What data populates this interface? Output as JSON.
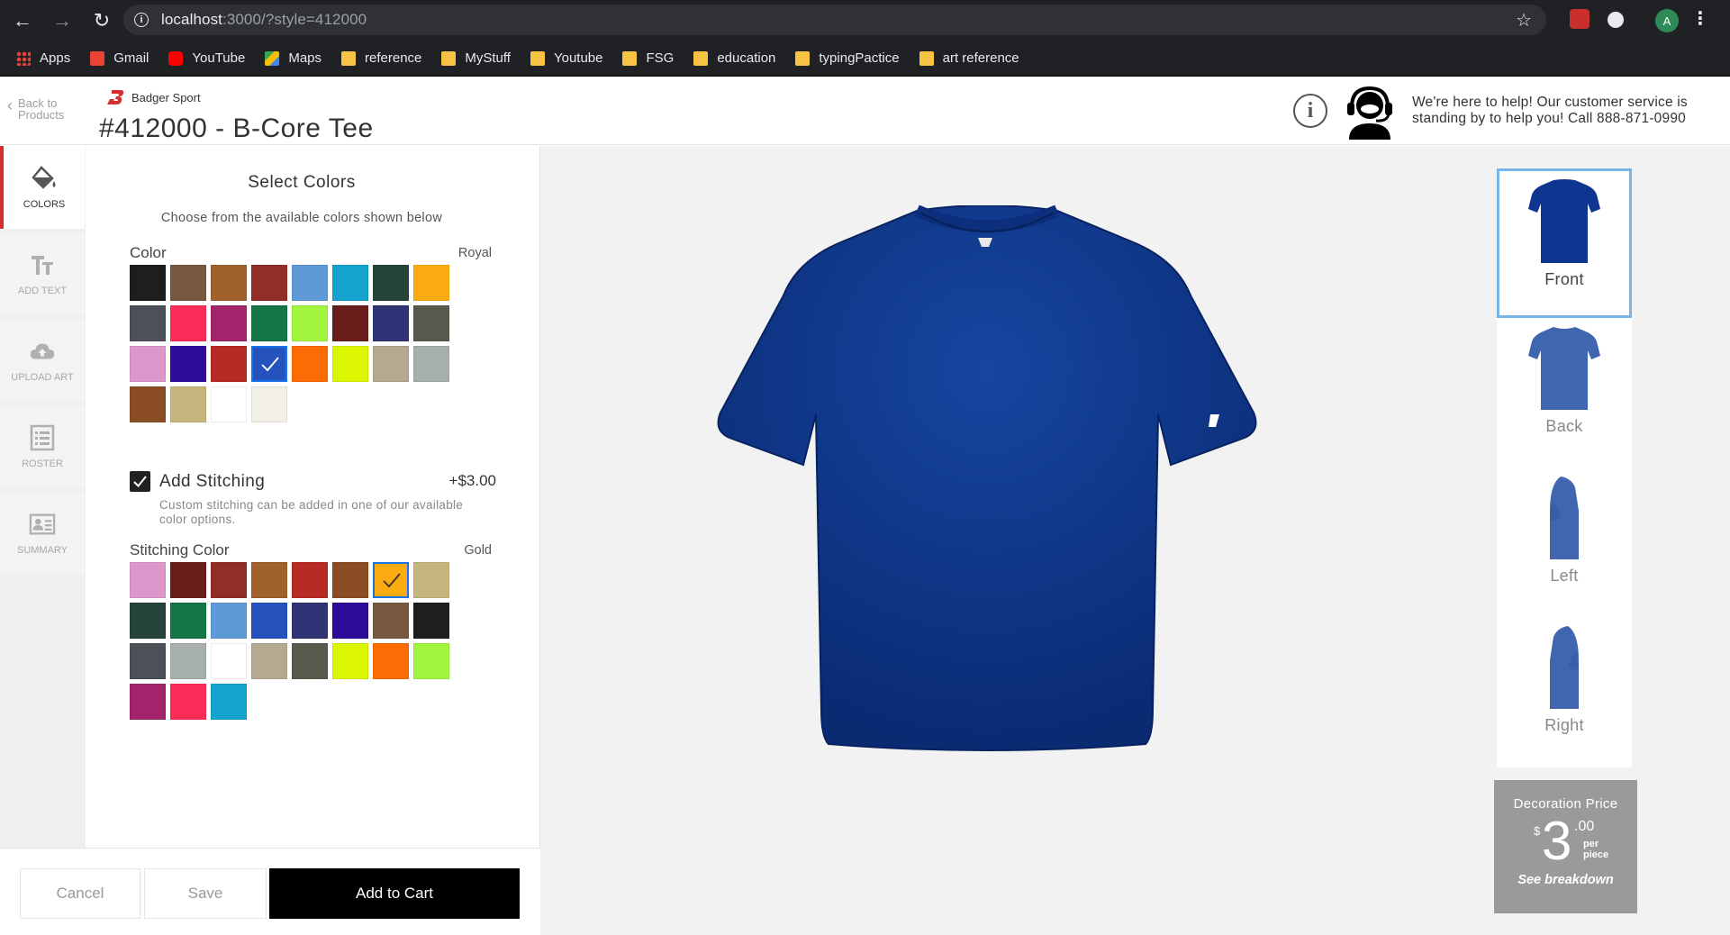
{
  "browser": {
    "url_host": "localhost",
    "url_rest": ":3000/?style=412000",
    "profile_initial": "A",
    "bookmarks": [
      {
        "label": "Apps",
        "icon": "apps-grid-icon"
      },
      {
        "label": "Gmail",
        "icon": "gmail-icon"
      },
      {
        "label": "YouTube",
        "icon": "youtube-icon"
      },
      {
        "label": "Maps",
        "icon": "maps-icon"
      },
      {
        "label": "reference",
        "icon": "folder-icon"
      },
      {
        "label": "MyStuff",
        "icon": "folder-icon"
      },
      {
        "label": "Youtube",
        "icon": "folder-icon"
      },
      {
        "label": "FSG",
        "icon": "folder-icon"
      },
      {
        "label": "education",
        "icon": "folder-icon"
      },
      {
        "label": "typingPactice",
        "icon": "folder-icon"
      },
      {
        "label": "art reference",
        "icon": "folder-icon"
      }
    ]
  },
  "header": {
    "back_line1": "Back to",
    "back_line2": "Products",
    "brand": "Badger Sport",
    "title": "#412000 - B-Core Tee",
    "support_text": "We're here to help! Our customer service is standing by to help you! Call 888-871-0990"
  },
  "rail": [
    {
      "label": "COLORS",
      "icon": "paint-bucket-icon",
      "active": true
    },
    {
      "label": "ADD TEXT",
      "icon": "text-icon",
      "active": false
    },
    {
      "label": "UPLOAD ART",
      "icon": "cloud-upload-icon",
      "active": false
    },
    {
      "label": "ROSTER",
      "icon": "roster-list-icon",
      "active": false
    },
    {
      "label": "SUMMARY",
      "icon": "summary-card-icon",
      "active": false
    }
  ],
  "colors_panel": {
    "title": "Select Colors",
    "subtitle": "Choose from the available colors shown below",
    "color_label": "Color",
    "color_selected": "Royal",
    "color_swatches": [
      "#1e1e1e",
      "#76583f",
      "#a0612a",
      "#922e2a",
      "#5e9bd6",
      "#14a3cf",
      "#26443a",
      "#fbab12",
      "#4b5157",
      "#fb2d58",
      "#a3246b",
      "#137644",
      "#a1f53d",
      "#6a1e1b",
      "#2f3476",
      "#57594d",
      "#de97cb",
      "#2e0b98",
      "#b72923",
      "#2552bd",
      "#fd6b05",
      "#dbf600",
      "#b5aa91",
      "#a7afac",
      "#8a4c23",
      "#c6b57d",
      "#ffffff",
      "#f2efe6"
    ],
    "color_selected_index": 19,
    "stitching_checked": true,
    "stitching_label": "Add Stitching",
    "stitching_price": "+$3.00",
    "stitching_desc": "Custom stitching can be added in one of our available color options.",
    "stitch_color_label": "Stitching Color",
    "stitch_color_selected": "Gold",
    "stitch_swatches": [
      "#de97cb",
      "#6a1e1b",
      "#922e2a",
      "#a0612a",
      "#b72923",
      "#8a4c23",
      "#fbab12",
      "#c6b57d",
      "#26443a",
      "#137644",
      "#5e9bd6",
      "#2552bd",
      "#2f3476",
      "#2e0b98",
      "#76583f",
      "#1e1e1e",
      "#4b5157",
      "#a7afac",
      "#ffffff",
      "#b5aa91",
      "#57594d",
      "#dbf600",
      "#fd6b05",
      "#a1f53d",
      "#a3246b",
      "#fb2d58",
      "#14a3cf"
    ],
    "stitch_selected_index": 6
  },
  "actions": {
    "cancel": "Cancel",
    "save": "Save",
    "add_to_cart": "Add to Cart"
  },
  "preview": {
    "shirt_color": "#0a2d7a",
    "views": [
      {
        "label": "Front",
        "active": true
      },
      {
        "label": "Back",
        "active": false
      },
      {
        "label": "Left",
        "active": false
      },
      {
        "label": "Right",
        "active": false
      }
    ]
  },
  "price": {
    "title": "Decoration Price",
    "currency": "$",
    "whole": "3",
    "cents": ".00",
    "per_line1": "per",
    "per_line2": "piece",
    "link": "See breakdown"
  }
}
